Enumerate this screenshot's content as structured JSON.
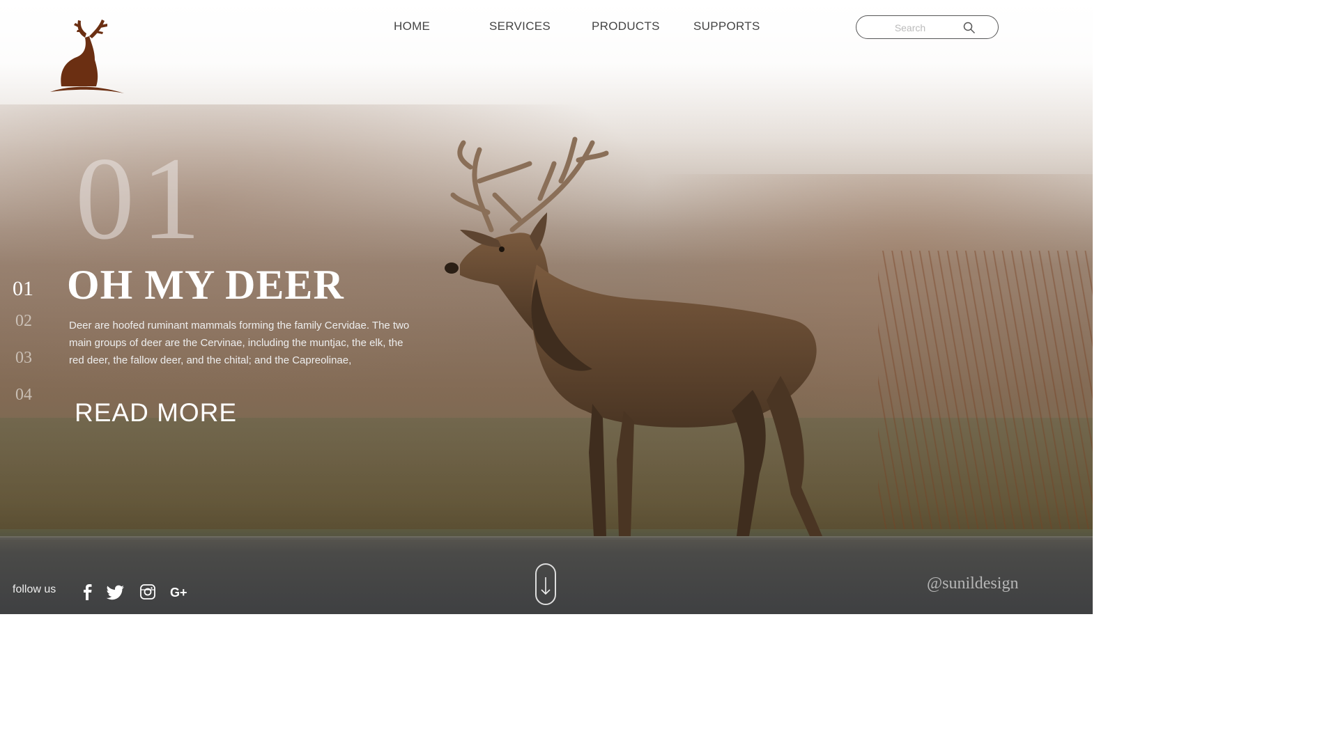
{
  "header": {
    "nav": [
      {
        "label": "HOME"
      },
      {
        "label": "SERVICES"
      },
      {
        "label": "PRODUCTS"
      },
      {
        "label": "SUPPORTS"
      }
    ],
    "search": {
      "placeholder": "Search",
      "value": ""
    }
  },
  "hero": {
    "big_number": "01",
    "title": "OH MY DEER",
    "description": "Deer are hoofed ruminant mammals forming the family Cervidae. The two main groups of deer are the Cervinae, including the muntjac, the elk, the red deer, the fallow deer, and the chital; and the Capreolinae,",
    "read_more": "READ MORE"
  },
  "slides": [
    {
      "label": "01",
      "active": true
    },
    {
      "label": "02",
      "active": false
    },
    {
      "label": "03",
      "active": false
    },
    {
      "label": "04",
      "active": false
    }
  ],
  "footer": {
    "follow_label": "follow us",
    "social_icons": [
      "facebook-icon",
      "twitter-icon",
      "instagram-icon",
      "google-plus-icon"
    ],
    "watermark": "@sunildesign"
  },
  "colors": {
    "logo": "#6b2f12",
    "nav_text": "#444444",
    "title": "#ffffff"
  }
}
